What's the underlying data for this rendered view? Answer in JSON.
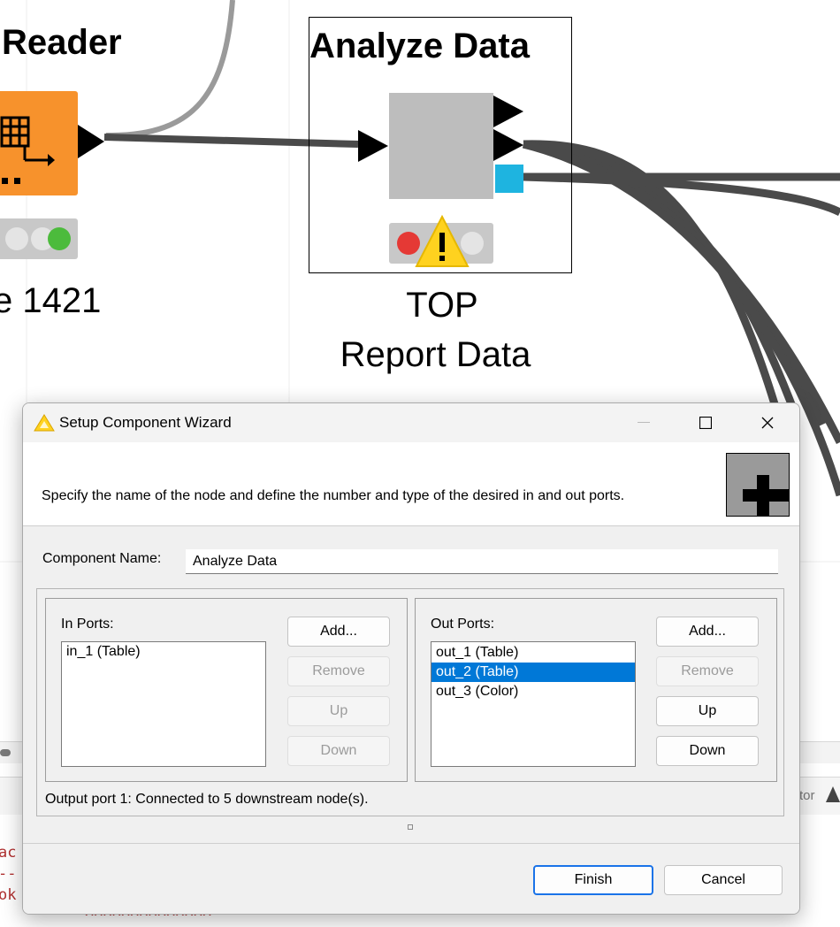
{
  "workflow": {
    "reader_node": {
      "title": "Reader",
      "label": "e 1421"
    },
    "analyze_node": {
      "title": "Analyze Data",
      "label_line1": "TOP",
      "label_line2": "Report Data"
    },
    "console": {
      "lines": [
        "ac",
        "--",
        "ok",
        "^^^^^^^^^^^^^^"
      ],
      "side_text": "tor"
    }
  },
  "dialog": {
    "title": "Setup Component Wizard",
    "banner_text": "Specify the name of the node and define the number and type of the desired in and out ports.",
    "component_name_label": "Component Name:",
    "component_name_value": "Analyze Data",
    "in_ports": {
      "label": "In Ports:",
      "items": [
        "in_1 (Table)"
      ],
      "buttons": {
        "add": "Add...",
        "remove": "Remove",
        "up": "Up",
        "down": "Down"
      }
    },
    "out_ports": {
      "label": "Out Ports:",
      "items": [
        "out_1 (Table)",
        "out_2 (Table)",
        "out_3 (Color)"
      ],
      "selected_index": 1,
      "buttons": {
        "add": "Add...",
        "remove": "Remove",
        "up": "Up",
        "down": "Down"
      }
    },
    "status_text": "Output port 1: Connected to 5 downstream node(s).",
    "finish_label": "Finish",
    "cancel_label": "Cancel",
    "colors": {
      "selection": "#0078d7",
      "node_orange": "#f7922c",
      "node_gray": "#bdbdbd",
      "port_cyan": "#1eb4e0",
      "warning_yellow": "#ffd21f"
    }
  }
}
